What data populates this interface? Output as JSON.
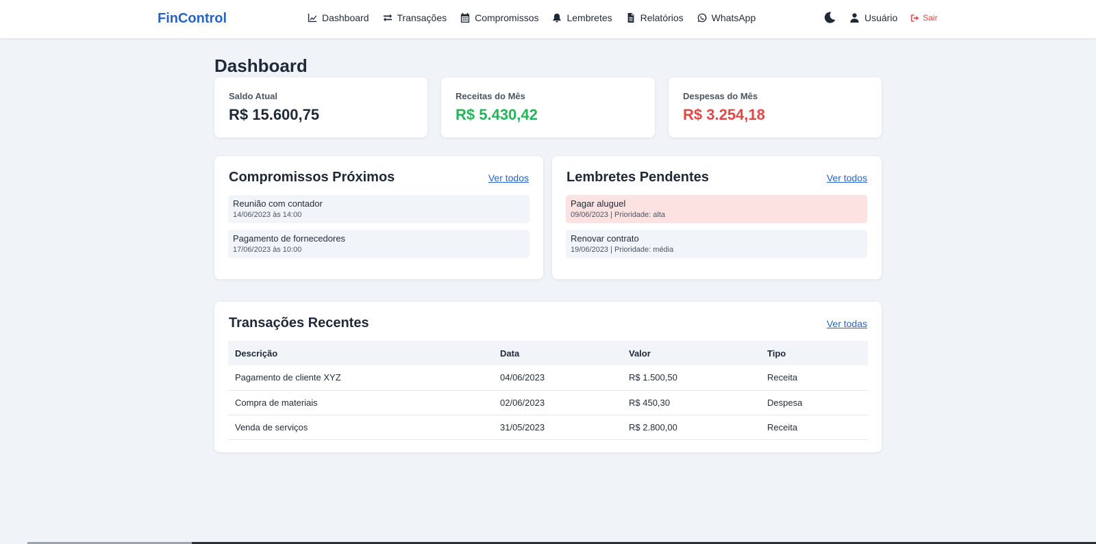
{
  "navbar": {
    "brand": "FinControl",
    "links": [
      {
        "label": "Dashboard",
        "icon": "chart-line-icon"
      },
      {
        "label": "Transações",
        "icon": "exchange-icon"
      },
      {
        "label": "Compromissos",
        "icon": "calendar-icon"
      },
      {
        "label": "Lembretes",
        "icon": "bell-icon"
      },
      {
        "label": "Relatórios",
        "icon": "file-icon"
      },
      {
        "label": "WhatsApp",
        "icon": "whatsapp-icon"
      }
    ],
    "theme_icon": "moon-icon",
    "user_label": "Usuário",
    "logout_label": "Sair"
  },
  "page": {
    "title": "Dashboard"
  },
  "stats": [
    {
      "label": "Saldo Atual",
      "value": "R$ 15.600,75",
      "color": "#1f2937"
    },
    {
      "label": "Receitas do Mês",
      "value": "R$ 5.430,42",
      "color": "#22b55a"
    },
    {
      "label": "Despesas do Mês",
      "value": "R$ 3.254,18",
      "color": "#e04848"
    }
  ],
  "compromissos": {
    "title": "Compromissos Próximos",
    "see_all": "Ver todos",
    "items": [
      {
        "title": "Reunião com contador",
        "sub": "14/06/2023 às 14:00"
      },
      {
        "title": "Pagamento de fornecedores",
        "sub": "17/06/2023 às 10:00"
      }
    ]
  },
  "lembretes": {
    "title": "Lembretes Pendentes",
    "see_all": "Ver todos",
    "items": [
      {
        "title": "Pagar aluguel",
        "sub": "09/06/2023 | Prioridade: alta",
        "priority": "alta"
      },
      {
        "title": "Renovar contrato",
        "sub": "19/06/2023 | Prioridade: média",
        "priority": "média"
      }
    ]
  },
  "transacoes": {
    "title": "Transações Recentes",
    "see_all": "Ver todas",
    "columns": [
      "Descrição",
      "Data",
      "Valor",
      "Tipo"
    ],
    "rows": [
      {
        "descricao": "Pagamento de cliente XYZ",
        "data": "04/06/2023",
        "valor": "R$ 1.500,50",
        "tipo": "Receita"
      },
      {
        "descricao": "Compra de materiais",
        "data": "02/06/2023",
        "valor": "R$ 450,30",
        "tipo": "Despesa"
      },
      {
        "descricao": "Venda de serviços",
        "data": "31/05/2023",
        "valor": "R$ 2.800,00",
        "tipo": "Receita"
      }
    ]
  },
  "colors": {
    "accent": "#2563c9",
    "income": "#22b55a",
    "expense": "#e04848",
    "background": "#f0f3f8"
  }
}
